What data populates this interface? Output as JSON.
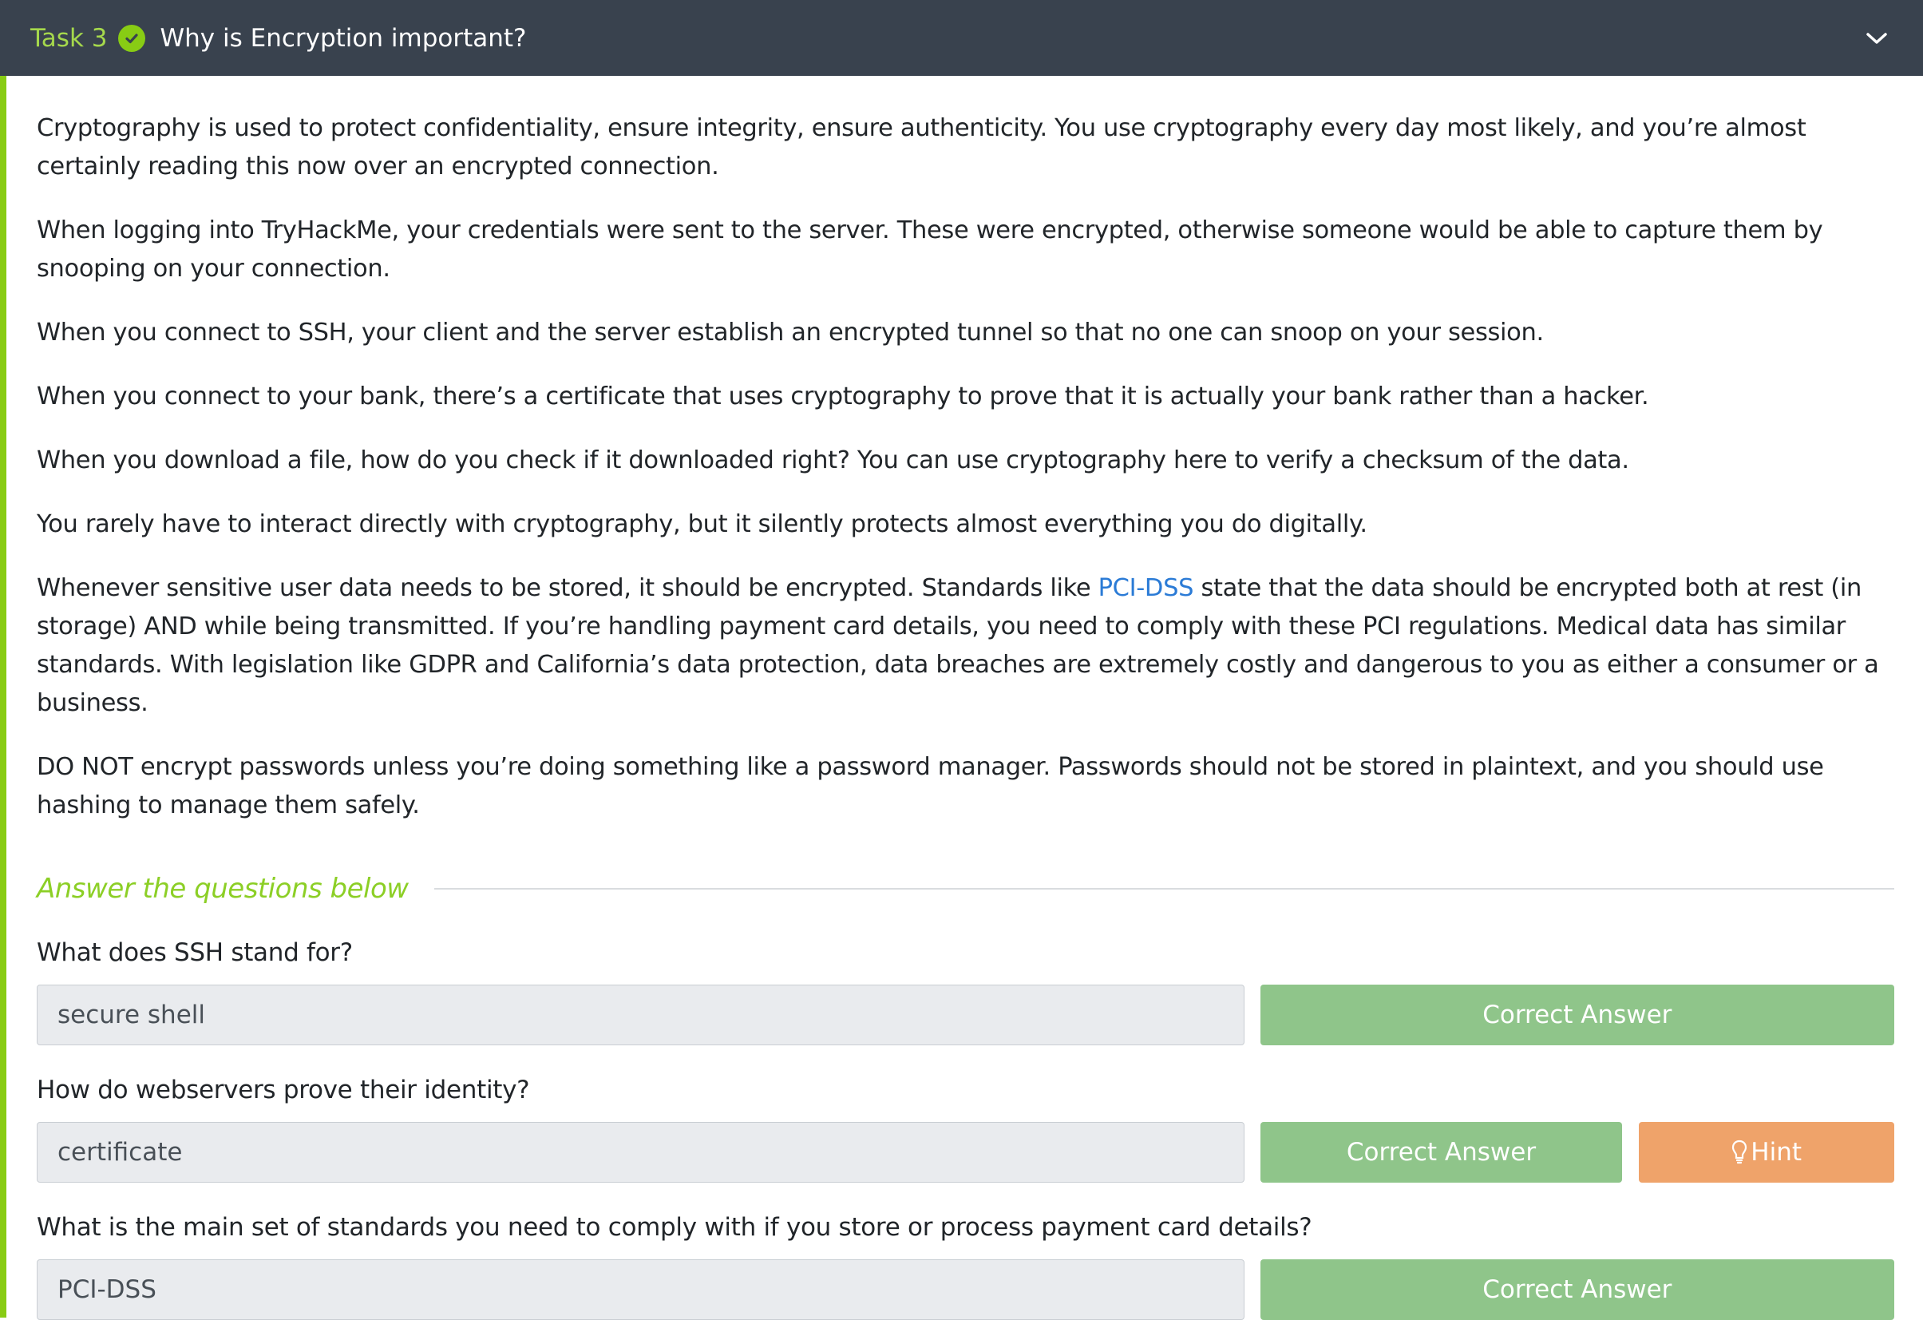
{
  "task": {
    "number_label": "Task 3",
    "title": "Why is Encryption important?"
  },
  "paragraphs": [
    "Cryptography is used to protect confidentiality, ensure integrity, ensure authenticity. You use cryptography every day most likely, and you’re almost certainly reading this now over an encrypted connection.",
    "When logging into TryHackMe, your credentials were sent to the server. These were encrypted, otherwise someone would be able to capture them by snooping on your connection.",
    "When you connect to SSH, your client and the server establish an encrypted tunnel so that no one can snoop on your session.",
    "When you connect to your bank, there’s a certificate that uses cryptography to prove that it is actually your bank rather than a hacker.",
    "When you download a file, how do you check if it downloaded right? You can use cryptography here to verify a checksum of the data.",
    "You rarely have to interact directly with cryptography, but it silently protects almost everything you do digitally."
  ],
  "standards_paragraph": {
    "before_link": "Whenever sensitive user data needs to be stored, it should be encrypted. Standards like ",
    "link_text": "PCI-DSS",
    "after_link": " state that the data should be encrypted both at rest (in storage) AND while being transmitted. If you’re handling payment card details, you need to comply with these PCI regulations. Medical data has similar standards. With legislation like GDPR and California’s data protection, data breaches are extremely costly and dangerous to you as either a consumer or a business."
  },
  "passwords_paragraph": "DO NOT encrypt passwords unless you’re doing something like a password manager. Passwords should not be stored in plaintext, and you should use hashing to manage them safely.",
  "answers": {
    "heading": "Answer the questions below",
    "questions": [
      {
        "text": "What does SSH stand for?",
        "answer": "secure shell",
        "button": "Correct Answer"
      },
      {
        "text": "How do webservers prove their identity?",
        "answer": "certificate",
        "button": "Correct Answer",
        "hint": "Hint"
      },
      {
        "text": "What is the main set of standards you need to comply with if you store or process payment card details?",
        "answer": "PCI-DSS",
        "button": "Correct Answer"
      }
    ]
  },
  "colors": {
    "header_bg": "#39424e",
    "accent_green": "#88cc14",
    "correct_button": "#8fc58a",
    "hint_button": "#efa36a",
    "link": "#2b7bd6"
  },
  "icons": [
    "check-circle-icon",
    "chevron-down-icon",
    "lightbulb-icon"
  ]
}
